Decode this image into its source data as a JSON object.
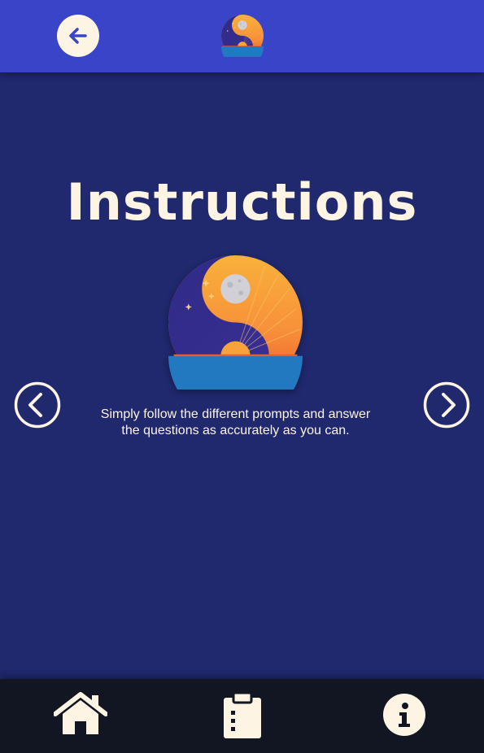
{
  "header": {
    "back_icon": "arrow-left-icon",
    "logo_icon": "yin-yang-day-night-logo"
  },
  "main": {
    "title": "Instructions",
    "instruction_line1": "Simply follow the different prompts and answer",
    "instruction_line2": "the questions as accurately as you can.",
    "prev_icon": "chevron-left-circle-icon",
    "next_icon": "chevron-right-circle-icon"
  },
  "footer": {
    "items": [
      {
        "icon": "home-icon"
      },
      {
        "icon": "clipboard-list-icon"
      },
      {
        "icon": "info-icon"
      }
    ]
  },
  "colors": {
    "header_bg": "#3a44c9",
    "page_bg": "#20286e",
    "footer_bg": "#121522",
    "cream": "#fdf4e3",
    "sun_orange": "#f4883a",
    "sea_blue": "#2379c0"
  }
}
